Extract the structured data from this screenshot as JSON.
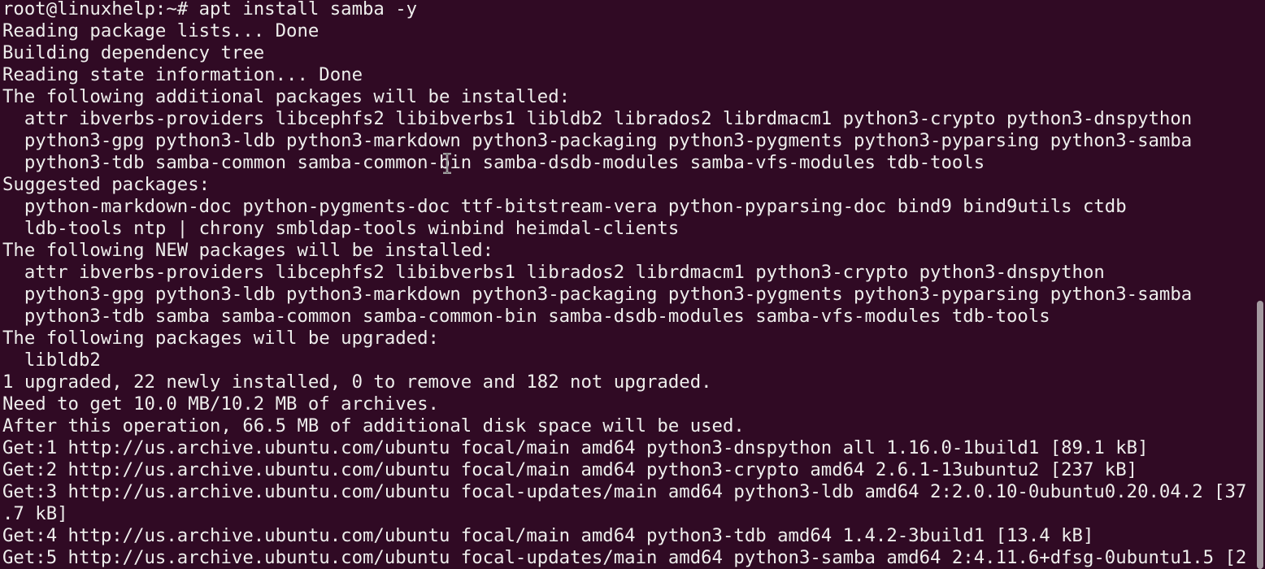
{
  "terminal": {
    "colors": {
      "background": "#300a24",
      "foreground": "#eeeeec",
      "scrollbar": "#a49aa0"
    },
    "lines": [
      "root@linuxhelp:~# apt install samba -y",
      "Reading package lists... Done",
      "Building dependency tree",
      "Reading state information... Done",
      "The following additional packages will be installed:",
      "  attr ibverbs-providers libcephfs2 libibverbs1 libldb2 librados2 librdmacm1 python3-crypto python3-dnspython",
      "  python3-gpg python3-ldb python3-markdown python3-packaging python3-pygments python3-pyparsing python3-samba",
      "  python3-tdb samba-common samba-common-bin samba-dsdb-modules samba-vfs-modules tdb-tools",
      "Suggested packages:",
      "  python-markdown-doc python-pygments-doc ttf-bitstream-vera python-pyparsing-doc bind9 bind9utils ctdb",
      "  ldb-tools ntp | chrony smbldap-tools winbind heimdal-clients",
      "The following NEW packages will be installed:",
      "  attr ibverbs-providers libcephfs2 libibverbs1 librados2 librdmacm1 python3-crypto python3-dnspython",
      "  python3-gpg python3-ldb python3-markdown python3-packaging python3-pygments python3-pyparsing python3-samba",
      "  python3-tdb samba samba-common samba-common-bin samba-dsdb-modules samba-vfs-modules tdb-tools",
      "The following packages will be upgraded:",
      "  libldb2",
      "1 upgraded, 22 newly installed, 0 to remove and 182 not upgraded.",
      "Need to get 10.0 MB/10.2 MB of archives.",
      "After this operation, 66.5 MB of additional disk space will be used.",
      "Get:1 http://us.archive.ubuntu.com/ubuntu focal/main amd64 python3-dnspython all 1.16.0-1build1 [89.1 kB]",
      "Get:2 http://us.archive.ubuntu.com/ubuntu focal/main amd64 python3-crypto amd64 2.6.1-13ubuntu2 [237 kB]",
      "Get:3 http://us.archive.ubuntu.com/ubuntu focal-updates/main amd64 python3-ldb amd64 2:2.0.10-0ubuntu0.20.04.2 [37",
      ".7 kB]",
      "Get:4 http://us.archive.ubuntu.com/ubuntu focal/main amd64 python3-tdb amd64 1.4.2-3build1 [13.4 kB]",
      "Get:5 http://us.archive.ubuntu.com/ubuntu focal-updates/main amd64 python3-samba amd64 2:4.11.6+dfsg-0ubuntu1.5 [2"
    ],
    "pointer_icon": "i-beam-cursor-icon"
  }
}
